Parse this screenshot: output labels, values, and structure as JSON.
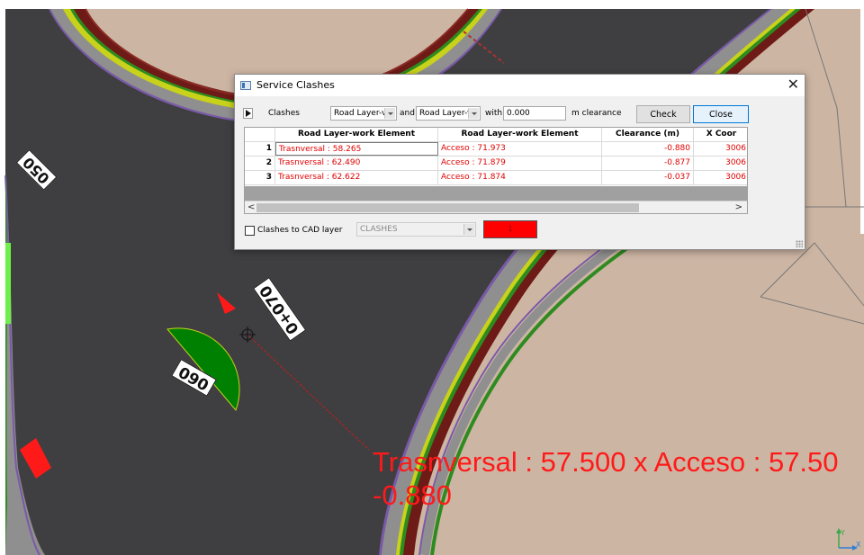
{
  "map": {
    "chainage_labels": [
      "050",
      "0+070",
      "060"
    ],
    "clash_label_line1": "Trasnversal : 57.500 x Acceso : 57.50",
    "clash_label_line2": "-0.880",
    "axis_y": "Y",
    "axis_x": "X",
    "colors": {
      "terrain": "#cdb5a3",
      "asphalt": "#3f3f41",
      "shoulder_gray": "#8f8f8f",
      "green_line": "#2e8b1f",
      "dark_red_edge": "#6e1a16",
      "clash_red": "#ff1a1a",
      "marker_green": "#008000"
    }
  },
  "dialog": {
    "title": "Service Clashes",
    "clashes_label": "Clashes",
    "layer_combo_1": "Road Layer-v",
    "and_label": "and",
    "layer_combo_2": "Road Layer-v",
    "with_label": "with",
    "clearance_value": "0.000",
    "m_clearance_label": "m clearance",
    "check_button": "Check",
    "close_button": "Close",
    "table": {
      "headers": [
        "",
        "Road Layer-work Element",
        "Road Layer-work Element",
        "Clearance (m)",
        "X Coor"
      ],
      "rows": [
        {
          "n": "1",
          "a": "Trasnversal : 58.265",
          "b": "Acceso : 71.973",
          "clearance": "-0.880",
          "x": "3006"
        },
        {
          "n": "2",
          "a": "Trasnversal : 62.490",
          "b": "Acceso : 71.879",
          "clearance": "-0.877",
          "x": "3006"
        },
        {
          "n": "3",
          "a": "Trasnversal : 62.622",
          "b": "Acceso : 71.874",
          "clearance": "-0.037",
          "x": "3006"
        }
      ]
    },
    "clashes_to_cad_label": "Clashes to CAD layer",
    "cad_layer_combo": "CLASHES",
    "color_swatch_value": "1",
    "swatch_color": "#ff0000"
  }
}
